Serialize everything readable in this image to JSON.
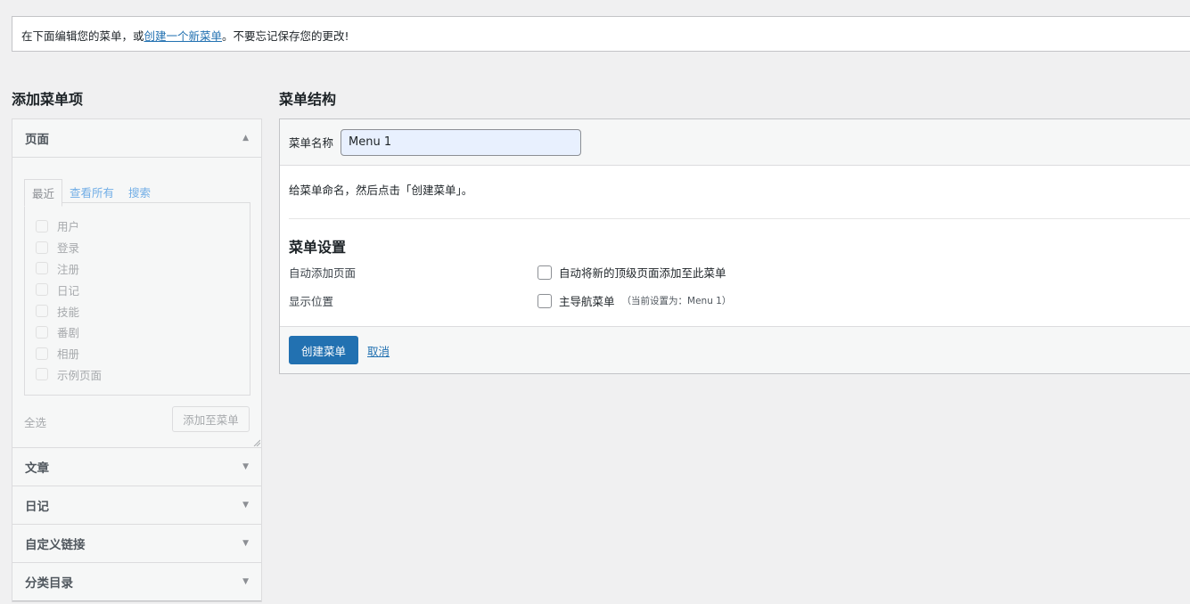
{
  "notice": {
    "prefix": "在下面编辑您的菜单，或",
    "link": "创建一个新菜单",
    "suffix": "。不要忘记保存您的更改!"
  },
  "left": {
    "title": "添加菜单项",
    "pages_section": {
      "label": "页面",
      "tabs": [
        "最近",
        "查看所有",
        "搜索"
      ],
      "items": [
        "用户",
        "登录",
        "注册",
        "日记",
        "技能",
        "番剧",
        "相册",
        "示例页面"
      ],
      "select_all": "全选",
      "add_button": "添加至菜单"
    },
    "sections": [
      "文章",
      "日记",
      "自定义链接",
      "分类目录"
    ]
  },
  "right": {
    "title": "菜单结构",
    "name_label": "菜单名称",
    "name_value": "Menu 1",
    "hint": "给菜单命名，然后点击「创建菜单」。",
    "settings_title": "菜单设置",
    "auto_add_label": "自动添加页面",
    "auto_add_option": "自动将新的顶级页面添加至此菜单",
    "location_label": "显示位置",
    "location_option": "主导航菜单",
    "location_note": "（当前设置为：Menu 1）",
    "create_button": "创建菜单",
    "cancel_link": "取消"
  },
  "colors": {
    "primary": "#2271b1",
    "background": "#f0f0f1"
  }
}
